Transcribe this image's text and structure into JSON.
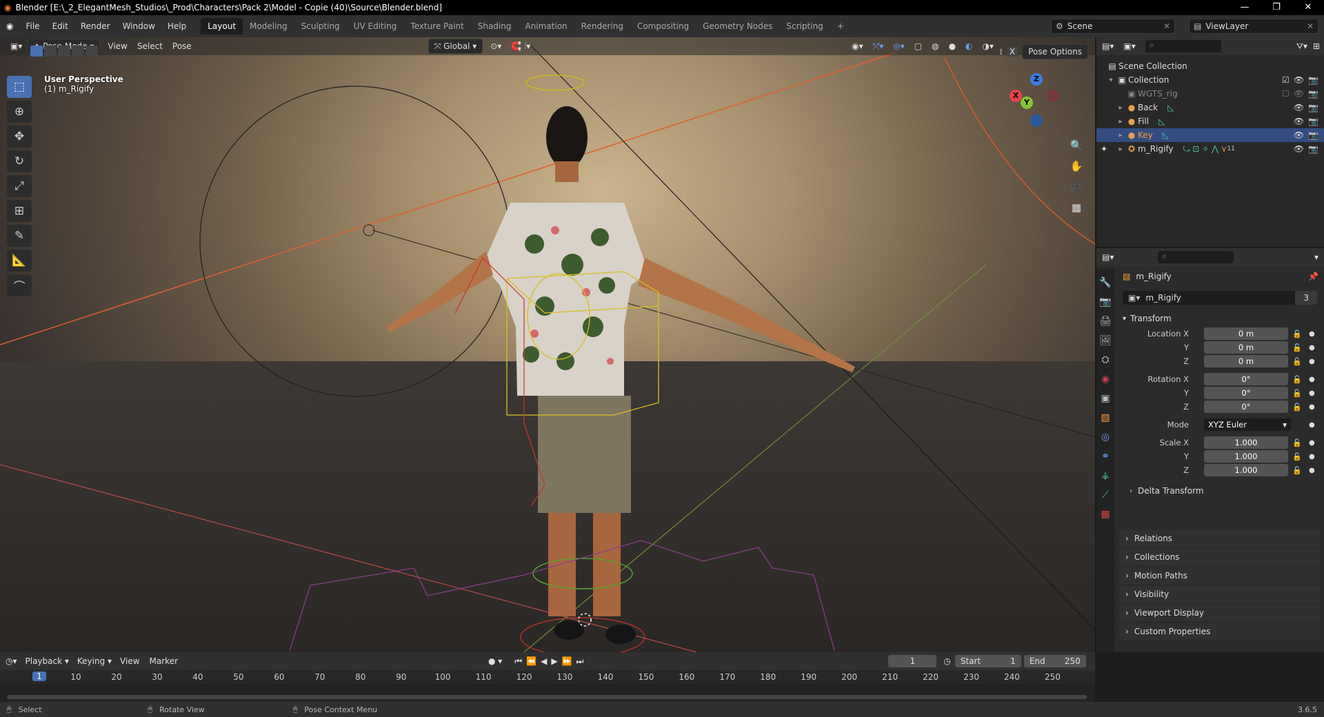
{
  "window": {
    "title": "Blender [E:\\_2_ElegantMesh_Studios\\_Prod\\Characters\\Pack 2\\Model - Copie (40)\\Source\\Blender.blend]",
    "min": "—",
    "restore": "❐",
    "close": "✕"
  },
  "menu": [
    "File",
    "Edit",
    "Render",
    "Window",
    "Help"
  ],
  "workspaces": [
    "Layout",
    "Modeling",
    "Sculpting",
    "UV Editing",
    "Texture Paint",
    "Shading",
    "Animation",
    "Rendering",
    "Compositing",
    "Geometry Nodes",
    "Scripting",
    "+"
  ],
  "active_workspace": "Layout",
  "scene": {
    "name": "Scene",
    "view_layer": "ViewLayer"
  },
  "viewport": {
    "mode": "Pose Mode",
    "menus": [
      "View",
      "Select",
      "Pose"
    ],
    "orientation": "Global",
    "pose_options": "Pose Options",
    "overlay_title": "User Perspective",
    "overlay_object": "(1) m_Rigify",
    "gizmo_axes": {
      "z": "Z",
      "y": "Y",
      "x": "X"
    }
  },
  "tools": [
    "select-box",
    "cursor",
    "move",
    "rotate",
    "scale",
    "transform",
    "annotate",
    "measure",
    "bone-envelope"
  ],
  "outliner": {
    "root": "Scene Collection",
    "collection": "Collection",
    "items": [
      {
        "name": "WGTS_rig",
        "dim": true
      },
      {
        "name": "Back",
        "dim": false
      },
      {
        "name": "Fill",
        "dim": false
      },
      {
        "name": "Key",
        "dim": false,
        "selected": true
      },
      {
        "name": "m_Rigify",
        "dim": false,
        "badge": "11"
      }
    ]
  },
  "properties": {
    "object_name": "m_Rigify",
    "datablock_name": "m_Rigify",
    "datablock_users": "3",
    "transform_label": "Transform",
    "location": {
      "label": "Location X",
      "x": "0 m",
      "y": "0 m",
      "z": "0 m"
    },
    "rotation": {
      "label": "Rotation X",
      "x": "0°",
      "y": "0°",
      "z": "0°"
    },
    "mode_label": "Mode",
    "mode_value": "XYZ Euler",
    "scale": {
      "label": "Scale X",
      "x": "1.000",
      "y": "1.000",
      "z": "1.000"
    },
    "axis_y": "Y",
    "axis_z": "Z",
    "delta": "Delta Transform",
    "panels": [
      "Relations",
      "Collections",
      "Motion Paths",
      "Visibility",
      "Viewport Display",
      "Custom Properties"
    ]
  },
  "timeline": {
    "menus": [
      "Playback",
      "Keying",
      "View",
      "Marker"
    ],
    "current_frame": "1",
    "start_label": "Start",
    "start": "1",
    "end_label": "End",
    "end": "250",
    "ruler": [
      "1",
      "10",
      "20",
      "30",
      "40",
      "50",
      "60",
      "70",
      "80",
      "90",
      "100",
      "110",
      "120",
      "130",
      "140",
      "150",
      "160",
      "170",
      "180",
      "190",
      "200",
      "210",
      "220",
      "230",
      "240",
      "250"
    ]
  },
  "status": {
    "select": "Select",
    "rotate": "Rotate View",
    "context": "Pose Context Menu",
    "version": "3.6.5"
  }
}
